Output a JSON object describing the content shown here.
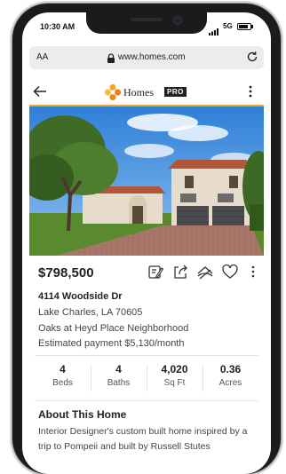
{
  "status": {
    "time": "10:30 AM",
    "network": "5G",
    "battery_level": 0.8
  },
  "browser": {
    "text_size_label": "AA",
    "url": "www.homes.com"
  },
  "appbar": {
    "brand": "Homes",
    "brand_badge": "PRO"
  },
  "listing": {
    "price": "$798,500",
    "street": "4114 Woodside Dr",
    "city_line": "Lake Charles, LA 70605",
    "neighborhood": "Oaks at Heyd Place Neighborhood",
    "estimated_payment": "Estimated payment $5,130/month"
  },
  "stats": [
    {
      "value": "4",
      "label": "Beds"
    },
    {
      "value": "4",
      "label": "Baths"
    },
    {
      "value": "4,020",
      "label": "Sq Ft"
    },
    {
      "value": "0.36",
      "label": "Acres"
    }
  ],
  "about": {
    "title": "About This Home",
    "text": "Interior Designer's custom built home inspired by a trip to Pompeii and built by Russell Stutes"
  },
  "colors": {
    "accent": "#f5a623",
    "sky": "#3a86d9",
    "stucco": "#e7dccb",
    "roof": "#b0563a",
    "lawn": "#5a8a2e",
    "driveway": "#a8776a"
  },
  "icons": [
    "back-arrow-icon",
    "more-vertical-icon",
    "lock-icon",
    "reload-icon",
    "edit-note-icon",
    "share-icon",
    "hide-icon",
    "heart-icon",
    "more-icon"
  ]
}
